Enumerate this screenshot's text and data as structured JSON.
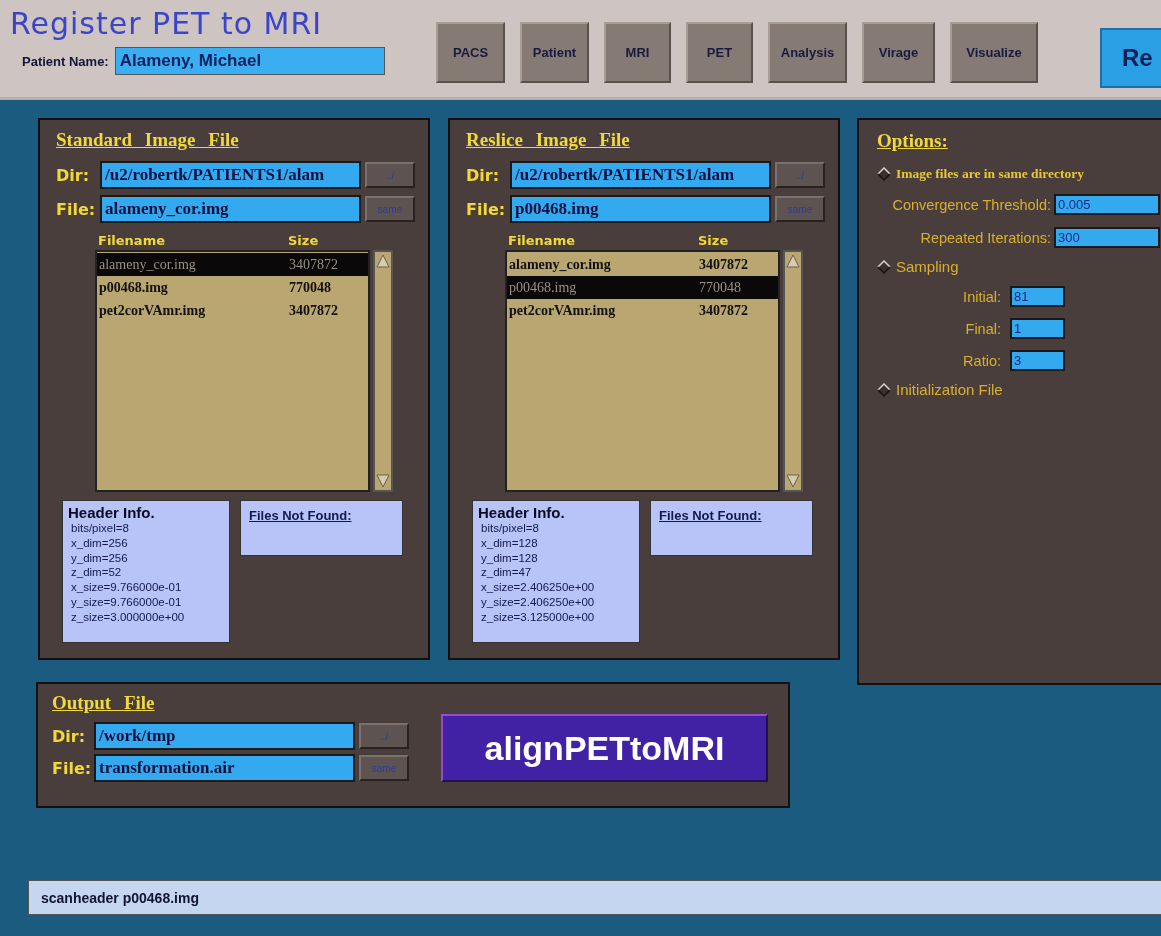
{
  "window": {
    "title": "Register PET to MRI"
  },
  "patient": {
    "label": "Patient Name:",
    "value": "Alameny, Michael"
  },
  "nav_buttons": [
    {
      "label": "PACS"
    },
    {
      "label": "Patient"
    },
    {
      "label": "MRI"
    },
    {
      "label": "PET"
    },
    {
      "label": "Analysis"
    },
    {
      "label": "Virage"
    },
    {
      "label": "Visualize"
    }
  ],
  "run_button": {
    "label": "Re"
  },
  "file_panels": [
    {
      "title": "Standard Image File",
      "dir_label": "Dir:",
      "dir": "/u2/robertk/PATIENTS1/alam",
      "file_label": "File:",
      "file": "alameny_cor.img",
      "up_button": "../",
      "same_button": "same",
      "columns": [
        "Filename",
        "Size"
      ],
      "rows": [
        {
          "name": "alameny_cor.img",
          "size": "3407872",
          "selected": true
        },
        {
          "name": "p00468.img",
          "size": "770048",
          "selected": false
        },
        {
          "name": "pet2corVAmr.img",
          "size": "3407872",
          "selected": false
        }
      ],
      "header_info": {
        "title": "Header Info.",
        "lines": [
          "bits/pixel=8",
          "x_dim=256",
          "y_dim=256",
          "z_dim=52",
          "x_size=9.766000e-01",
          "y_size=9.766000e-01",
          "z_size=3.000000e+00"
        ]
      },
      "not_found": {
        "title": "Files Not Found:"
      }
    },
    {
      "title": "Reslice Image File",
      "dir_label": "Dir:",
      "dir": "/u2/robertk/PATIENTS1/alam",
      "file_label": "File:",
      "file": "p00468.img",
      "up_button": "../",
      "same_button": "same",
      "columns": [
        "Filename",
        "Size"
      ],
      "rows": [
        {
          "name": "alameny_cor.img",
          "size": "3407872",
          "selected": false
        },
        {
          "name": "p00468.img",
          "size": "770048",
          "selected": true
        },
        {
          "name": "pet2corVAmr.img",
          "size": "3407872",
          "selected": false
        }
      ],
      "header_info": {
        "title": "Header Info.",
        "lines": [
          "bits/pixel=8",
          "x_dim=128",
          "y_dim=128",
          "z_dim=47",
          "x_size=2.406250e+00",
          "y_size=2.406250e+00",
          "z_size=3.125000e+00"
        ]
      },
      "not_found": {
        "title": "Files Not Found:"
      }
    }
  ],
  "options": {
    "title": "Options:",
    "items": [
      {
        "kind": "check",
        "label": "Image files are in same directory",
        "checked": false
      },
      {
        "kind": "field",
        "label": "Convergence Threshold:",
        "value": "0.005"
      },
      {
        "kind": "field",
        "label": "Repeated Iterations:",
        "value": "300"
      },
      {
        "kind": "toggle",
        "label": "Sampling",
        "checked": false
      },
      {
        "kind": "subfield",
        "label": "Initial:",
        "value": "81"
      },
      {
        "kind": "subfield",
        "label": "Final:",
        "value": "1"
      },
      {
        "kind": "subfield",
        "label": "Ratio:",
        "value": "3"
      },
      {
        "kind": "toggle",
        "label": "Initialization File",
        "checked": false
      }
    ]
  },
  "output": {
    "title": "Output File",
    "dir_label": "Dir:",
    "dir": "/work/tmp",
    "file_label": "File:",
    "file": "transformation.air",
    "up_button": "../",
    "same_button": "same",
    "run_button": "alignPETtoMRI"
  },
  "status_bar": {
    "text": "scanheader p00468.img"
  }
}
